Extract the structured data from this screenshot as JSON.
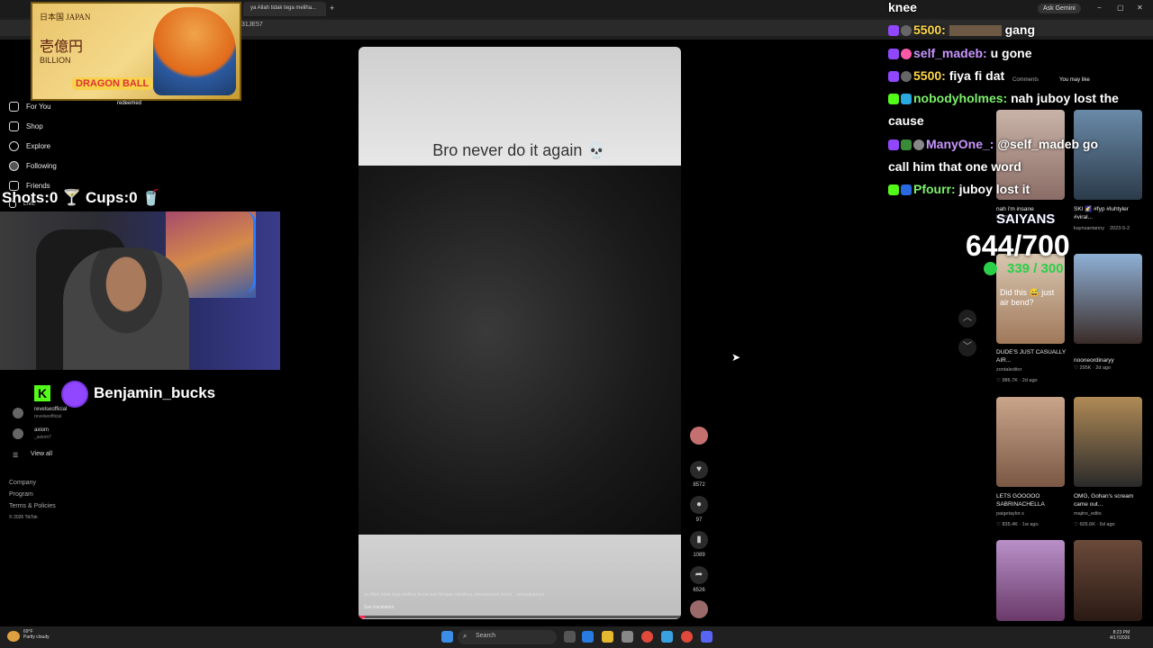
{
  "browser": {
    "tab_active": "ya Allah tidak tega meliha...",
    "url": "t=ZT-9Scvq31JE57",
    "ask_gemini": "Ask Gemini",
    "window_controls": [
      "−",
      "▢",
      "✕"
    ]
  },
  "sidebar": {
    "items": [
      {
        "label": "For You",
        "icon": "home-icon"
      },
      {
        "label": "Shop",
        "icon": "shop-icon"
      },
      {
        "label": "Explore",
        "icon": "compass-icon"
      },
      {
        "label": "Following",
        "icon": "following-icon"
      },
      {
        "label": "Friends",
        "icon": "friends-icon"
      },
      {
        "label": "LIVE",
        "icon": "live-icon"
      }
    ],
    "following": [
      {
        "name": "revelseofficial",
        "handle": "revelseofficial"
      },
      {
        "name": "axiom",
        "handle": "_axiom7"
      }
    ],
    "view_all": "View all",
    "footer": [
      "Company",
      "Program",
      "Terms & Policies",
      "© 2026 TikTok"
    ]
  },
  "overlay": {
    "card_line1": "日本国 JAPAN",
    "card_line2": "壱億円",
    "card_line3": "BILLION",
    "card_logo": "DRAGON BALL",
    "redeemed": "redeemed",
    "shots_cups": "Shots:0 🍸 Cups:0 🥤",
    "streamer": "Benjamin_bucks"
  },
  "video": {
    "caption": "Bro never do it again 💀",
    "subtitle": "ya Allah tidak tega melihat bonar aut dengan cobalnya, perasaanlah nmeli... selengkapnya",
    "translation": "See translation",
    "progress": 0.02
  },
  "actions": [
    {
      "icon": "like-icon",
      "count": "8572",
      "glyph": "♥"
    },
    {
      "icon": "comment-icon",
      "count": "97",
      "glyph": "●"
    },
    {
      "icon": "bookmark-icon",
      "count": "1089",
      "glyph": "▮"
    },
    {
      "icon": "share-icon",
      "count": "6526",
      "glyph": "➦"
    }
  ],
  "chat": [
    {
      "user": "",
      "msg": "knee",
      "color": "#ffffff"
    },
    {
      "user": "5500:",
      "msg": "gang",
      "color": "#ffd84a"
    },
    {
      "user": "self_madeb:",
      "msg": "u gone",
      "color": "#c896ff"
    },
    {
      "user": "5500:",
      "msg": "fiya fi dat",
      "color": "#ffd84a"
    },
    {
      "user": "nobodyholmes:",
      "msg": "nah juboy lost the",
      "color": "#7cf06a"
    },
    {
      "user": "",
      "msg": "cause",
      "color": "#ffffff"
    },
    {
      "user": "ManyOne_:",
      "msg": "@self_madeb go",
      "color": "#c896ff"
    },
    {
      "user": "",
      "msg": "call him that one word",
      "color": "#ffffff"
    },
    {
      "user": "Pfourr:",
      "msg": "juboy lost it",
      "color": "#7cf06a"
    }
  ],
  "goal": {
    "title": "SAIYANS",
    "big": "644/700",
    "small": "339 / 300"
  },
  "right_panel": {
    "tab1": "Comments",
    "tab2": "You may like",
    "thumbs": [
      {
        "caption": "nah i'm insane",
        "user": "jayrows",
        "meta": ""
      },
      {
        "caption": "SKI 🌠 #fyp #luhtyler #viral...",
        "user": "kaynsantanny",
        "meta": "2023-5-2"
      },
      {
        "caption": "DUDE'S JUST CASUALLY AIR...",
        "user": "zontaleditor",
        "meta": "♡ 986.7K · 2d ago"
      },
      {
        "caption": "",
        "user": "nooneordinaryy",
        "meta": "♡ 295K · 2d ago"
      },
      {
        "caption": "LETS GOOOOO SABRINACHELLA",
        "user": "paigetaylor.s",
        "meta": "♡ 835.4K · 1w ago"
      },
      {
        "caption": "OMG, Gohan's scream came out...",
        "user": "majinx_edits",
        "meta": "♡ 605.6K · 6d ago"
      }
    ],
    "thumb_overlay": "Did this 😅 just air bend?"
  },
  "taskbar": {
    "weather_temp": "69°F",
    "weather_desc": "Partly cloudy",
    "search": "Search",
    "time": "8:23 PM",
    "date": "4/17/2026"
  }
}
